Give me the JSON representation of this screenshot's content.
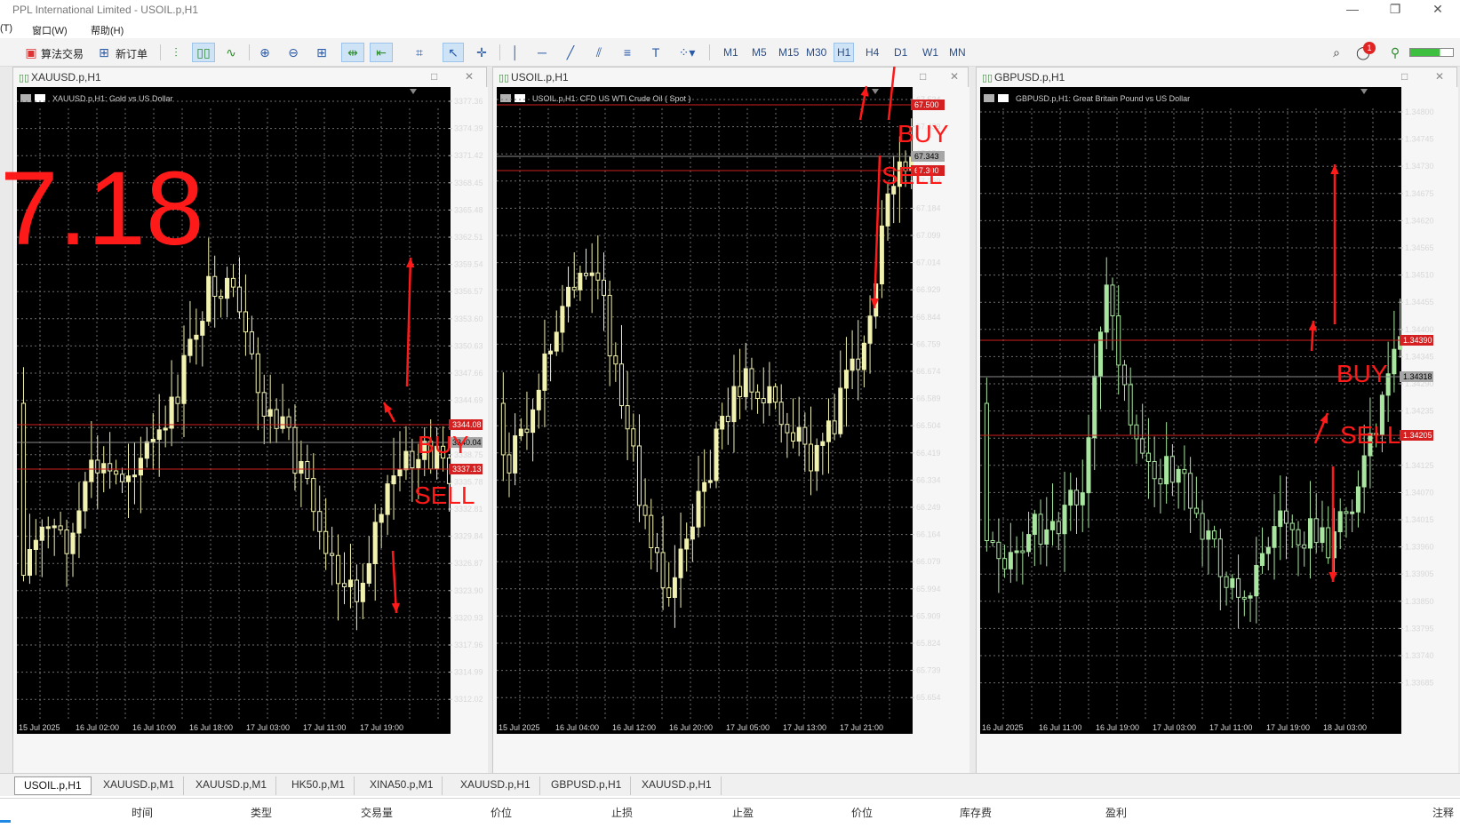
{
  "window": {
    "title": "PPL International Limited - USOIL.p,H1"
  },
  "menu": [
    "(T)",
    "窗口(W)",
    "帮助(H)"
  ],
  "toolbar": {
    "algo_label": "算法交易",
    "new_order_label": "新订单",
    "timeframes": [
      "M1",
      "M5",
      "M15",
      "M30",
      "H1",
      "H4",
      "D1",
      "W1",
      "MN"
    ],
    "active_timeframe": "H1",
    "notification_count": "1"
  },
  "overlay": {
    "big_number": "7.18",
    "buy": "BUY",
    "sell": "SELL",
    "color": "#ff1a1a"
  },
  "charts": [
    {
      "id": "xau",
      "window_label": "XAUUSD.p,H1",
      "info": "XAUUSD.p,H1:  Gold vs US Dollar",
      "candle_color": "#f2f2b0",
      "price_labels": [
        "3377.36",
        "3374.39",
        "3371.42",
        "3368.45",
        "3365.48",
        "3362.51",
        "3359.54",
        "3356.57",
        "3353.60",
        "3350.63",
        "3347.66",
        "3344.69",
        "3341.72",
        "3338.75",
        "3335.78",
        "3332.81",
        "3329.84",
        "3326.87",
        "3323.90",
        "3320.93",
        "3317.96",
        "3314.99",
        "3312.02"
      ],
      "current_price": "3340.04",
      "upper_line_price": "3344.08",
      "lower_line_price": "3337.13",
      "time_labels": [
        "15 Jul 2025",
        "16 Jul 02:00",
        "16 Jul 10:00",
        "16 Jul 18:00",
        "17 Jul 03:00",
        "17 Jul 11:00",
        "17 Jul 19:00"
      ]
    },
    {
      "id": "oil",
      "window_label": "USOIL.p,H1",
      "info": "USOIL.p,H1:  CFD US WTI Crude Oil ( Spot )",
      "candle_color": "#f2f2b0",
      "price_labels": [
        "67.524",
        "67.439",
        "67.354",
        "67.269",
        "67.184",
        "67.099",
        "67.014",
        "66.929",
        "66.844",
        "66.759",
        "66.674",
        "66.589",
        "66.504",
        "66.419",
        "66.334",
        "66.249",
        "66.164",
        "66.079",
        "65.994",
        "65.909",
        "65.824",
        "65.739",
        "65.654"
      ],
      "current_price": "67.343",
      "upper_line_price": "67.500",
      "lower_line_price": "67.300",
      "time_labels": [
        "15 Jul 2025",
        "16 Jul 04:00",
        "16 Jul 12:00",
        "16 Jul 20:00",
        "17 Jul 05:00",
        "17 Jul 13:00",
        "17 Jul 21:00"
      ]
    },
    {
      "id": "gbp",
      "window_label": "GBPUSD.p,H1",
      "info": "GBPUSD.p,H1:  Great Britain Pound vs US Dollar",
      "candle_color": "#a8e6a0",
      "price_labels": [
        "1.34800",
        "1.34745",
        "1.34730",
        "1.34675",
        "1.34620",
        "1.34565",
        "1.34510",
        "1.34455",
        "1.34400",
        "1.34345",
        "1.34290",
        "1.34235",
        "1.34180",
        "1.34125",
        "1.34070",
        "1.34015",
        "1.33960",
        "1.33905",
        "1.33850",
        "1.33795",
        "1.33740",
        "1.33685"
      ],
      "current_price": "1.34318",
      "upper_line_price": "1.34390",
      "lower_line_price": "1.34205",
      "time_labels": [
        "16 Jul 2025",
        "16 Jul 11:00",
        "16 Jul 19:00",
        "17 Jul 03:00",
        "17 Jul 11:00",
        "17 Jul 19:00",
        "18 Jul 03:00"
      ]
    }
  ],
  "symbol_tabs": [
    "USOIL.p,H1",
    "XAUUSD.p,M1",
    "XAUUSD.p,M1",
    "HK50.p,M1",
    "XINA50.p,M1",
    "XAUUSD.p,H1",
    "GBPUSD.p,H1",
    "XAUUSD.p,H1"
  ],
  "columns": [
    "时间",
    "类型",
    "交易量",
    "价位",
    "止损",
    "止盈",
    "价位",
    "库存费",
    "盈利",
    "注释"
  ]
}
